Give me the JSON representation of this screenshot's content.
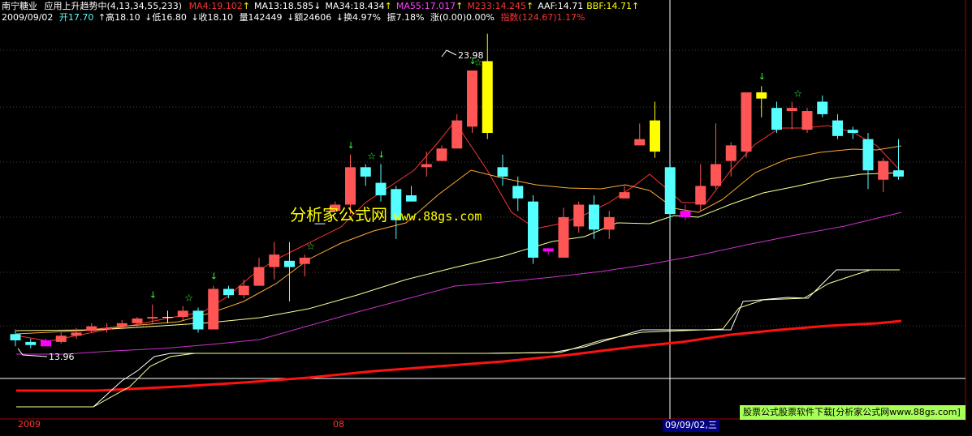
{
  "header": {
    "stock_name": "南宁糖业",
    "indicator_name": "应用上升趋势中(4,13,34,55,233)",
    "ma_values": [
      {
        "label": "MA4:19.102",
        "arrow": "↑",
        "color": "#ff3333"
      },
      {
        "label": "MA13:18.585",
        "arrow": "↓",
        "color": "#ffffff"
      },
      {
        "label": "MA34:18.434",
        "arrow": "↑",
        "color": "#ffffff"
      },
      {
        "label": "MA55:17.017",
        "arrow": "↑",
        "color": "#ff44ff"
      },
      {
        "label": "M233:14.245",
        "arrow": "↑",
        "color": "#ff3333"
      },
      {
        "label": "AAF:14.71",
        "arrow": "",
        "color": "#ffffff"
      },
      {
        "label": "BBF:14.71",
        "arrow": "↑",
        "color": "#ffff00"
      }
    ]
  },
  "quote": {
    "date": "2009/09/02",
    "open": "开17.70",
    "high": "↑高18.10",
    "low": "↓低16.80",
    "close": "↓收18.10",
    "volume": "量142449",
    "amount": "↓额24606",
    "turnover": "↓换4.97%",
    "amplitude": "振7.18%",
    "change": "涨(0.00)0.00%",
    "index": "指数(124.67)1.17%"
  },
  "annotations": {
    "high_price": "23.98",
    "low_price": "13.96"
  },
  "watermark": {
    "text": "分析家公式网",
    "url": "www.88gs.com"
  },
  "ad_banner": "股票公式股票软件下载[分析家公式网www.88gs.com]",
  "x_axis": {
    "labels": [
      "2009",
      "08"
    ],
    "cursor_date": "09/09/02,三"
  },
  "colors": {
    "up": "#ff5555",
    "down": "#55ffff",
    "limit_up": "#ffff00",
    "special": "#ff00ff",
    "ma4": "#ff3333",
    "ma13": "#ffaa33",
    "ma34": "#ffff99",
    "ma55": "#cc33cc",
    "m233": "#ff1111"
  },
  "chart_data": {
    "type": "candlestick",
    "price_range": [
      13.5,
      24.8
    ],
    "candles": [
      {
        "o": 14.35,
        "c": 14.15,
        "h": 14.5,
        "l": 13.96,
        "t": "down"
      },
      {
        "o": 14.1,
        "c": 14.0,
        "h": 14.2,
        "l": 13.9,
        "t": "down"
      },
      {
        "o": 13.96,
        "c": 14.15,
        "h": 14.2,
        "l": 13.96,
        "t": "special"
      },
      {
        "o": 14.1,
        "c": 14.3,
        "h": 14.4,
        "l": 14.05,
        "t": "up"
      },
      {
        "o": 14.3,
        "c": 14.4,
        "h": 14.55,
        "l": 14.2,
        "t": "up"
      },
      {
        "o": 14.45,
        "c": 14.6,
        "h": 14.7,
        "l": 14.4,
        "t": "up"
      },
      {
        "o": 14.5,
        "c": 14.55,
        "h": 14.7,
        "l": 14.4,
        "t": "up"
      },
      {
        "o": 14.6,
        "c": 14.7,
        "h": 14.8,
        "l": 14.5,
        "t": "up"
      },
      {
        "o": 14.7,
        "c": 14.85,
        "h": 14.9,
        "l": 14.6,
        "t": "up"
      },
      {
        "o": 14.85,
        "c": 14.9,
        "h": 15.3,
        "l": 14.7,
        "t": "up"
      },
      {
        "o": 14.9,
        "c": 14.9,
        "h": 15.1,
        "l": 14.7,
        "t": "doji"
      },
      {
        "o": 14.9,
        "c": 15.1,
        "h": 15.25,
        "l": 14.8,
        "t": "up"
      },
      {
        "o": 15.1,
        "c": 14.5,
        "h": 15.2,
        "l": 14.4,
        "t": "down"
      },
      {
        "o": 14.5,
        "c": 15.8,
        "h": 15.9,
        "l": 14.5,
        "t": "up"
      },
      {
        "o": 15.8,
        "c": 15.6,
        "h": 15.9,
        "l": 15.5,
        "t": "down"
      },
      {
        "o": 15.6,
        "c": 15.9,
        "h": 16.1,
        "l": 15.5,
        "t": "up"
      },
      {
        "o": 15.9,
        "c": 16.5,
        "h": 16.8,
        "l": 15.9,
        "t": "up"
      },
      {
        "o": 16.5,
        "c": 16.9,
        "h": 17.3,
        "l": 16.1,
        "t": "up"
      },
      {
        "o": 16.7,
        "c": 16.5,
        "h": 17.3,
        "l": 15.4,
        "t": "down"
      },
      {
        "o": 16.6,
        "c": 16.8,
        "h": 16.9,
        "l": 16.2,
        "t": "up"
      },
      {
        "o": 17.9,
        "c": 17.9,
        "h": 17.9,
        "l": 17.9,
        "t": "flat"
      },
      {
        "o": 18.3,
        "c": 18.5,
        "h": 18.6,
        "l": 18.3,
        "t": "up"
      },
      {
        "o": 18.5,
        "c": 19.7,
        "h": 20.1,
        "l": 18.2,
        "t": "up"
      },
      {
        "o": 19.7,
        "c": 19.4,
        "h": 19.8,
        "l": 19.1,
        "t": "down"
      },
      {
        "o": 18.8,
        "c": 19.2,
        "h": 19.8,
        "l": 18.6,
        "t": "down"
      },
      {
        "o": 19.0,
        "c": 18.0,
        "h": 19.1,
        "l": 17.4,
        "t": "down"
      },
      {
        "o": 18.6,
        "c": 18.8,
        "h": 19.1,
        "l": 18.6,
        "t": "down"
      },
      {
        "o": 19.8,
        "c": 19.7,
        "h": 20.2,
        "l": 19.4,
        "t": "up"
      },
      {
        "o": 19.9,
        "c": 20.3,
        "h": 20.4,
        "l": 19.9,
        "t": "up"
      },
      {
        "o": 20.3,
        "c": 21.2,
        "h": 21.4,
        "l": 20.3,
        "t": "up"
      },
      {
        "o": 21.0,
        "c": 22.8,
        "h": 22.8,
        "l": 20.8,
        "t": "up"
      },
      {
        "o": 20.8,
        "c": 23.1,
        "h": 23.98,
        "l": 20.6,
        "t": "limit"
      },
      {
        "o": 19.7,
        "c": 19.4,
        "h": 20.1,
        "l": 19.1,
        "t": "down"
      },
      {
        "o": 19.1,
        "c": 18.7,
        "h": 19.4,
        "l": 18.3,
        "t": "down"
      },
      {
        "o": 18.6,
        "c": 16.8,
        "h": 18.8,
        "l": 16.6,
        "t": "down"
      },
      {
        "o": 17.1,
        "c": 17.0,
        "h": 17.1,
        "l": 16.9,
        "t": "special"
      },
      {
        "o": 16.8,
        "c": 18.1,
        "h": 18.4,
        "l": 16.8,
        "t": "up"
      },
      {
        "o": 17.8,
        "c": 18.5,
        "h": 18.6,
        "l": 17.6,
        "t": "up"
      },
      {
        "o": 18.5,
        "c": 17.7,
        "h": 18.8,
        "l": 17.4,
        "t": "down"
      },
      {
        "o": 17.7,
        "c": 18.1,
        "h": 18.3,
        "l": 17.4,
        "t": "up"
      },
      {
        "o": 18.7,
        "c": 18.9,
        "h": 19.1,
        "l": 18.7,
        "t": "up"
      },
      {
        "o": 20.4,
        "c": 20.6,
        "h": 21.1,
        "l": 20.4,
        "t": "up"
      },
      {
        "o": 20.2,
        "c": 21.2,
        "h": 21.8,
        "l": 20.0,
        "t": "limit"
      },
      {
        "o": 19.7,
        "c": 18.2,
        "h": 19.8,
        "l": 18.0,
        "t": "down"
      },
      {
        "o": 18.1,
        "c": 18.3,
        "h": 18.5,
        "l": 18.0,
        "t": "special"
      },
      {
        "o": 18.5,
        "c": 19.1,
        "h": 19.8,
        "l": 18.3,
        "t": "up"
      },
      {
        "o": 19.1,
        "c": 19.8,
        "h": 21.1,
        "l": 19.0,
        "t": "up"
      },
      {
        "o": 19.9,
        "c": 20.4,
        "h": 20.5,
        "l": 19.4,
        "t": "up"
      },
      {
        "o": 20.2,
        "c": 22.1,
        "h": 22.1,
        "l": 20.0,
        "t": "up"
      },
      {
        "o": 22.1,
        "c": 21.9,
        "h": 22.3,
        "l": 21.3,
        "t": "limit"
      },
      {
        "o": 21.6,
        "c": 20.9,
        "h": 21.8,
        "l": 20.8,
        "t": "down"
      },
      {
        "o": 21.6,
        "c": 21.5,
        "h": 21.8,
        "l": 20.9,
        "t": "up"
      },
      {
        "o": 21.5,
        "c": 20.9,
        "h": 21.6,
        "l": 20.8,
        "t": "up"
      },
      {
        "o": 21.8,
        "c": 21.4,
        "h": 22.0,
        "l": 21.3,
        "t": "down"
      },
      {
        "o": 21.2,
        "c": 20.7,
        "h": 21.4,
        "l": 20.6,
        "t": "down"
      },
      {
        "o": 20.9,
        "c": 20.8,
        "h": 21.0,
        "l": 20.6,
        "t": "down"
      },
      {
        "o": 20.6,
        "c": 19.6,
        "h": 20.8,
        "l": 19.0,
        "t": "down"
      },
      {
        "o": 19.9,
        "c": 19.3,
        "h": 20.0,
        "l": 18.9,
        "t": "up"
      },
      {
        "o": 19.6,
        "c": 19.4,
        "h": 20.6,
        "l": 19.3,
        "t": "down"
      }
    ],
    "arrows": [
      9,
      13,
      22,
      24,
      30,
      49
    ],
    "stars": [
      11,
      19,
      23,
      30,
      51
    ],
    "lines": {
      "ma4": [
        [
          20,
          414
        ],
        [
          60,
          421
        ],
        [
          90,
          415
        ],
        [
          130,
          407
        ],
        [
          170,
          400
        ],
        [
          210,
          392
        ],
        [
          250,
          385
        ],
        [
          280,
          366
        ],
        [
          310,
          340
        ],
        [
          340,
          320
        ],
        [
          380,
          300
        ],
        [
          420,
          280
        ],
        [
          450,
          250
        ],
        [
          480,
          230
        ],
        [
          510,
          210
        ],
        [
          540,
          175
        ],
        [
          560,
          150
        ],
        [
          580,
          180
        ],
        [
          600,
          210
        ],
        [
          630,
          262
        ],
        [
          660,
          282
        ],
        [
          690,
          276
        ],
        [
          720,
          265
        ],
        [
          750,
          250
        ],
        [
          780,
          230
        ],
        [
          800,
          215
        ],
        [
          820,
          232
        ],
        [
          840,
          250
        ],
        [
          870,
          250
        ],
        [
          900,
          210
        ],
        [
          930,
          178
        ],
        [
          960,
          158
        ],
        [
          990,
          158
        ],
        [
          1020,
          155
        ],
        [
          1050,
          163
        ],
        [
          1080,
          180
        ],
        [
          1110,
          212
        ]
      ],
      "ma13": [
        [
          20,
          412
        ],
        [
          100,
          408
        ],
        [
          160,
          402
        ],
        [
          220,
          397
        ],
        [
          260,
          386
        ],
        [
          300,
          372
        ],
        [
          340,
          350
        ],
        [
          380,
          320
        ],
        [
          420,
          300
        ],
        [
          460,
          285
        ],
        [
          500,
          275
        ],
        [
          540,
          240
        ],
        [
          580,
          210
        ],
        [
          620,
          220
        ],
        [
          660,
          228
        ],
        [
          700,
          232
        ],
        [
          740,
          233
        ],
        [
          770,
          228
        ],
        [
          800,
          235
        ],
        [
          830,
          257
        ],
        [
          860,
          262
        ],
        [
          890,
          246
        ],
        [
          930,
          213
        ],
        [
          970,
          196
        ],
        [
          1010,
          188
        ],
        [
          1050,
          184
        ],
        [
          1080,
          185
        ],
        [
          1110,
          180
        ]
      ],
      "ma34": [
        [
          20,
          408
        ],
        [
          120,
          407
        ],
        [
          200,
          402
        ],
        [
          260,
          398
        ],
        [
          320,
          392
        ],
        [
          380,
          381
        ],
        [
          440,
          364
        ],
        [
          500,
          345
        ],
        [
          560,
          330
        ],
        [
          620,
          316
        ],
        [
          680,
          298
        ],
        [
          720,
          292
        ],
        [
          760,
          275
        ],
        [
          800,
          276
        ],
        [
          830,
          266
        ],
        [
          860,
          268
        ],
        [
          900,
          252
        ],
        [
          940,
          238
        ],
        [
          980,
          230
        ],
        [
          1020,
          221
        ],
        [
          1060,
          215
        ],
        [
          1110,
          213
        ]
      ],
      "ma55": [
        [
          20,
          437
        ],
        [
          80,
          437
        ],
        [
          140,
          433
        ],
        [
          200,
          430
        ],
        [
          260,
          425
        ],
        [
          320,
          419
        ],
        [
          380,
          402
        ],
        [
          440,
          385
        ],
        [
          500,
          369
        ],
        [
          560,
          353
        ],
        [
          620,
          348
        ],
        [
          680,
          342
        ],
        [
          740,
          335
        ],
        [
          800,
          326
        ],
        [
          860,
          315
        ],
        [
          920,
          302
        ],
        [
          980,
          290
        ],
        [
          1040,
          279
        ],
        [
          1110,
          262
        ]
      ],
      "m233": [
        [
          20,
          482
        ],
        [
          120,
          482
        ],
        [
          220,
          477
        ],
        [
          300,
          472
        ],
        [
          380,
          466
        ],
        [
          460,
          458
        ],
        [
          540,
          452
        ],
        [
          620,
          446
        ],
        [
          700,
          438
        ],
        [
          780,
          428
        ],
        [
          840,
          422
        ],
        [
          900,
          413
        ],
        [
          960,
          407
        ],
        [
          1020,
          402
        ],
        [
          1080,
          399
        ],
        [
          1110,
          396
        ]
      ],
      "aaf": [
        [
          20,
          502
        ],
        [
          115,
          502
        ],
        [
          150,
          470
        ],
        [
          170,
          457
        ],
        [
          190,
          440
        ],
        [
          210,
          436
        ],
        [
          260,
          436
        ],
        [
          400,
          436
        ],
        [
          600,
          436
        ],
        [
          680,
          435
        ],
        [
          720,
          428
        ],
        [
          790,
          407
        ],
        [
          820,
          407
        ],
        [
          900,
          407
        ],
        [
          915,
          372
        ],
        [
          970,
          367
        ],
        [
          995,
          368
        ],
        [
          1030,
          333
        ],
        [
          1072,
          333
        ],
        [
          1108,
          333
        ]
      ],
      "bbf": [
        [
          20,
          502
        ],
        [
          115,
          502
        ],
        [
          160,
          477
        ],
        [
          185,
          452
        ],
        [
          210,
          440
        ],
        [
          240,
          436
        ],
        [
          400,
          436
        ],
        [
          600,
          436
        ],
        [
          690,
          435
        ],
        [
          740,
          420
        ],
        [
          790,
          410
        ],
        [
          890,
          406
        ],
        [
          910,
          380
        ],
        [
          940,
          370
        ],
        [
          990,
          368
        ],
        [
          1020,
          350
        ],
        [
          1050,
          340
        ],
        [
          1072,
          333
        ],
        [
          1108,
          333
        ]
      ]
    }
  }
}
